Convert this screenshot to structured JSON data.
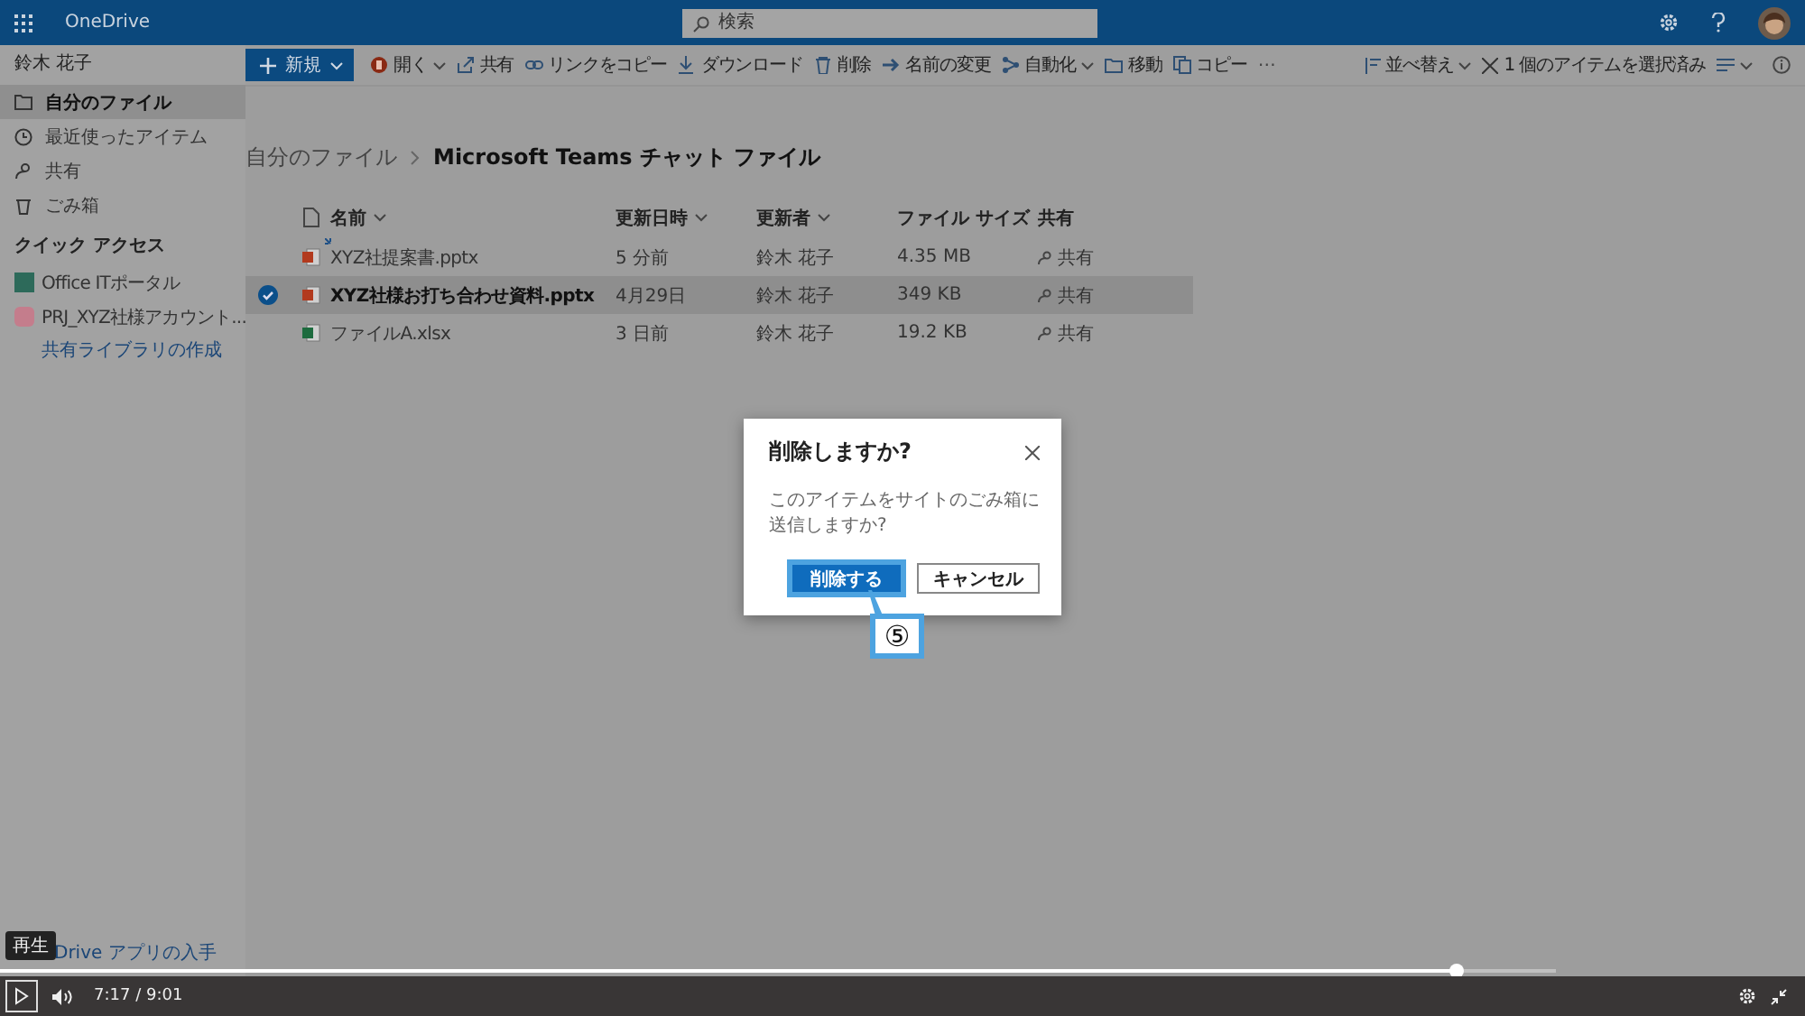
{
  "header": {
    "app_name": "OneDrive",
    "search": {
      "placeholder": "検索"
    }
  },
  "sidebar": {
    "user": "鈴木 花子",
    "items": [
      {
        "label": "自分のファイル",
        "selected": true
      },
      {
        "label": "最近使ったアイテム",
        "selected": false
      },
      {
        "label": "共有",
        "selected": false
      },
      {
        "label": "ごみ箱",
        "selected": false
      }
    ],
    "quick_access_title": "クイック アクセス",
    "quick_access": [
      {
        "label": "Office ITポータル",
        "color": "#2d6a5a"
      },
      {
        "label": "PRJ_XYZ社様アカウント...",
        "color": "#c47d8c"
      }
    ],
    "create_library_link": "共有ライブラリの作成",
    "app_link": "Drive アプリの入手"
  },
  "toolbar": {
    "new_button": "新規",
    "actions": [
      {
        "label": "開く",
        "caret": true
      },
      {
        "label": "共有",
        "caret": false
      },
      {
        "label": "リンクをコピー",
        "caret": false
      },
      {
        "label": "ダウンロード",
        "caret": false
      },
      {
        "label": "削除",
        "caret": false
      },
      {
        "label": "名前の変更",
        "caret": false
      },
      {
        "label": "自動化",
        "caret": true
      },
      {
        "label": "移動",
        "caret": false
      },
      {
        "label": "コピー",
        "caret": false
      }
    ],
    "more": "⋯",
    "sort": "並べ替え",
    "selection": "1 個のアイテムを選択済み"
  },
  "breadcrumb": [
    {
      "label": "自分のファイル",
      "current": false
    },
    {
      "label": "Microsoft Teams チャット ファイル",
      "current": true
    }
  ],
  "table": {
    "columns": [
      "名前",
      "更新日時",
      "更新者",
      "ファイル サイズ",
      "共有"
    ],
    "rows": [
      {
        "name": "XYZ社提案書.pptx",
        "kind": "pptx",
        "new": true,
        "modified": "5 分前",
        "modified_by": "鈴木 花子",
        "size": "4.35 MB",
        "sharing": "共有",
        "selected": false
      },
      {
        "name": "XYZ社様お打ち合わせ資料.pptx",
        "kind": "pptx",
        "new": false,
        "modified": "4月29日",
        "modified_by": "鈴木 花子",
        "size": "349 KB",
        "sharing": "共有",
        "selected": true
      },
      {
        "name": "ファイルA.xlsx",
        "kind": "xlsx",
        "new": false,
        "modified": "3 日前",
        "modified_by": "鈴木 花子",
        "size": "19.2 KB",
        "sharing": "共有",
        "selected": false
      }
    ]
  },
  "dialog": {
    "title": "削除しますか?",
    "message": "このアイテムをサイトのごみ箱に送信しますか?",
    "primary_button": "削除する",
    "secondary_button": "キャンセル"
  },
  "callout": "⑤",
  "video": {
    "tooltip": "再生",
    "time": "7:17 / 9:01",
    "level": 0.936
  }
}
